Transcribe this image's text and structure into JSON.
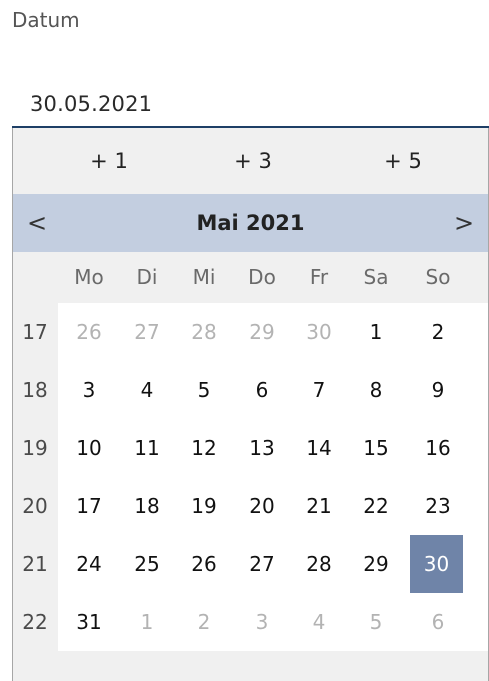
{
  "field": {
    "label": "Datum",
    "value": "30.05.2021"
  },
  "quick_buttons": [
    "+ 1",
    "+ 3",
    "+ 5"
  ],
  "calendar": {
    "month_title": "Mai 2021",
    "prev_label": "<",
    "next_label": ">",
    "weekdays": [
      "Mo",
      "Di",
      "Mi",
      "Do",
      "Fr",
      "Sa",
      "So"
    ],
    "selected": "30",
    "weeks": [
      {
        "number": "17",
        "days": [
          {
            "d": "26",
            "out": true
          },
          {
            "d": "27",
            "out": true
          },
          {
            "d": "28",
            "out": true
          },
          {
            "d": "29",
            "out": true
          },
          {
            "d": "30",
            "out": true
          },
          {
            "d": "1",
            "out": false
          },
          {
            "d": "2",
            "out": false
          }
        ]
      },
      {
        "number": "18",
        "days": [
          {
            "d": "3",
            "out": false
          },
          {
            "d": "4",
            "out": false
          },
          {
            "d": "5",
            "out": false
          },
          {
            "d": "6",
            "out": false
          },
          {
            "d": "7",
            "out": false
          },
          {
            "d": "8",
            "out": false
          },
          {
            "d": "9",
            "out": false
          }
        ]
      },
      {
        "number": "19",
        "days": [
          {
            "d": "10",
            "out": false
          },
          {
            "d": "11",
            "out": false
          },
          {
            "d": "12",
            "out": false
          },
          {
            "d": "13",
            "out": false
          },
          {
            "d": "14",
            "out": false
          },
          {
            "d": "15",
            "out": false
          },
          {
            "d": "16",
            "out": false
          }
        ]
      },
      {
        "number": "20",
        "days": [
          {
            "d": "17",
            "out": false
          },
          {
            "d": "18",
            "out": false
          },
          {
            "d": "19",
            "out": false
          },
          {
            "d": "20",
            "out": false
          },
          {
            "d": "21",
            "out": false
          },
          {
            "d": "22",
            "out": false
          },
          {
            "d": "23",
            "out": false
          }
        ]
      },
      {
        "number": "21",
        "days": [
          {
            "d": "24",
            "out": false
          },
          {
            "d": "25",
            "out": false
          },
          {
            "d": "26",
            "out": false
          },
          {
            "d": "27",
            "out": false
          },
          {
            "d": "28",
            "out": false
          },
          {
            "d": "29",
            "out": false
          },
          {
            "d": "30",
            "out": false,
            "selected": true
          }
        ]
      },
      {
        "number": "22",
        "days": [
          {
            "d": "31",
            "out": false
          },
          {
            "d": "1",
            "out": true
          },
          {
            "d": "2",
            "out": true
          },
          {
            "d": "3",
            "out": true
          },
          {
            "d": "4",
            "out": true
          },
          {
            "d": "5",
            "out": true
          },
          {
            "d": "6",
            "out": true
          }
        ]
      }
    ]
  },
  "colors": {
    "accent_underline": "#1e3f66",
    "header_bg": "#c3cee0",
    "selected_bg": "#6f84a8",
    "out_of_month_text": "#b3b3b3"
  },
  "icons": {
    "prev": "chevron-left-icon",
    "next": "chevron-right-icon"
  }
}
